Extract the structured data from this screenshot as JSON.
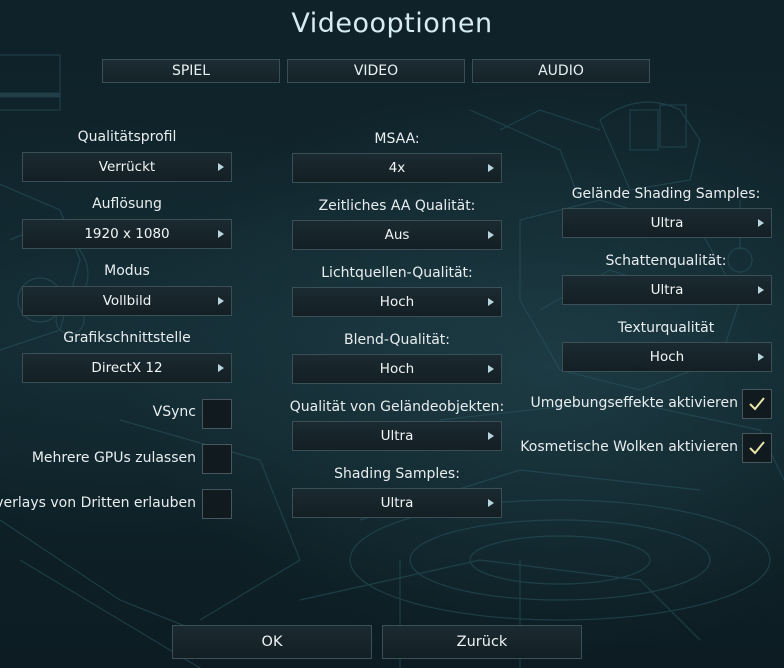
{
  "title": "Videooptionen",
  "tabs": [
    "SPIEL",
    "VIDEO",
    "AUDIO"
  ],
  "left": {
    "quality_profile": {
      "label": "Qualitätsprofil",
      "value": "Verrückt"
    },
    "resolution": {
      "label": "Auflösung",
      "value": "1920 x 1080"
    },
    "mode": {
      "label": "Modus",
      "value": "Vollbild"
    },
    "graphics_api": {
      "label": "Grafikschnittstelle",
      "value": "DirectX 12"
    },
    "vsync": {
      "label": "VSync",
      "checked": false
    },
    "multi_gpu": {
      "label": "Mehrere GPUs zulassen",
      "checked": false
    },
    "third_party_overlays": {
      "label": "Overlays von Dritten erlauben",
      "checked": false
    }
  },
  "middle": {
    "msaa": {
      "label": "MSAA:",
      "value": "4x"
    },
    "temporal_aa": {
      "label": "Zeitliches AA Qualität:",
      "value": "Aus"
    },
    "light_quality": {
      "label": "Lichtquellen-Qualität:",
      "value": "Hoch"
    },
    "blend_quality": {
      "label": "Blend-Qualität:",
      "value": "Hoch"
    },
    "terrain_objects": {
      "label": "Qualität von Geländeobjekten:",
      "value": "Ultra"
    },
    "shading_samples": {
      "label": "Shading Samples:",
      "value": "Ultra"
    }
  },
  "right": {
    "terrain_shading": {
      "label": "Gelände Shading Samples:",
      "value": "Ultra"
    },
    "shadow_quality": {
      "label": "Schattenqualität:",
      "value": "Ultra"
    },
    "texture_quality": {
      "label": "Texturqualität",
      "value": "Hoch"
    },
    "ambient_effects": {
      "label": "Umgebungseffekte aktivieren",
      "checked": true
    },
    "cosmetic_clouds": {
      "label": "Kosmetische Wolken aktivieren",
      "checked": true
    }
  },
  "buttons": {
    "ok": "OK",
    "back": "Zurück"
  },
  "colors": {
    "checkmark": "#e8e6a8",
    "frame": "#3b4f57",
    "background": "#10252c"
  }
}
